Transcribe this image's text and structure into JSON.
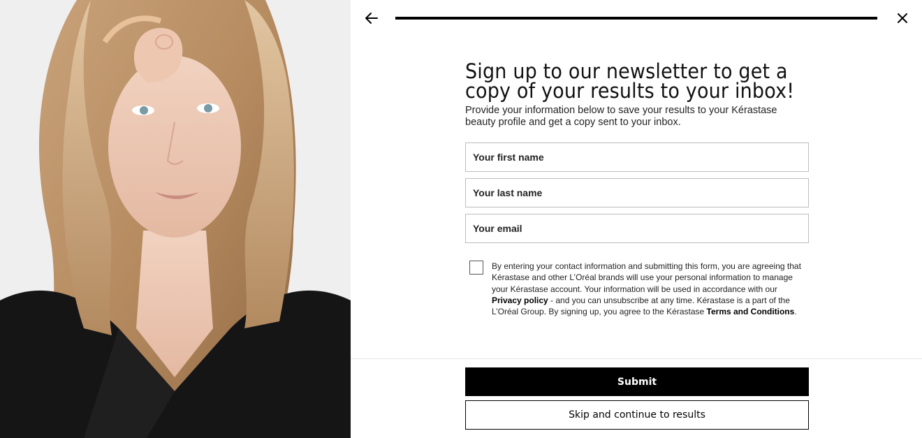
{
  "header": {
    "back_icon": "arrow-left-icon",
    "close_icon": "close-icon",
    "progress_fraction": 1.0
  },
  "hero_image": {
    "description_icon": "portrait-photo"
  },
  "form": {
    "title": "Sign up to our newsletter to get a copy of your results to your inbox!",
    "subtitle": "Provide your information below to save your results to your Kérastase beauty profile and get a copy sent to your inbox.",
    "first_name_placeholder": "Your first name",
    "last_name_placeholder": "Your last name",
    "email_placeholder": "Your email",
    "consent_text_1": "By entering your contact information and submitting this form, you are agreeing that Kérastase and other L’Oréal brands will use your personal information to manage your Kérastase account. Your information will be used in accordance with our ",
    "privacy_link": "Privacy policy",
    "consent_text_2": " - and you can unsubscribe at any time. Kérastase is a part of the L’Oréal Group. By signing up, you agree to the Kérastase ",
    "terms_link": "Terms and Conditions",
    "consent_text_3": "."
  },
  "actions": {
    "submit_label": "Submit",
    "skip_label": "Skip and continue to results"
  },
  "colors": {
    "primary": "#000000",
    "background": "#ffffff",
    "border": "#bdbdbd"
  }
}
